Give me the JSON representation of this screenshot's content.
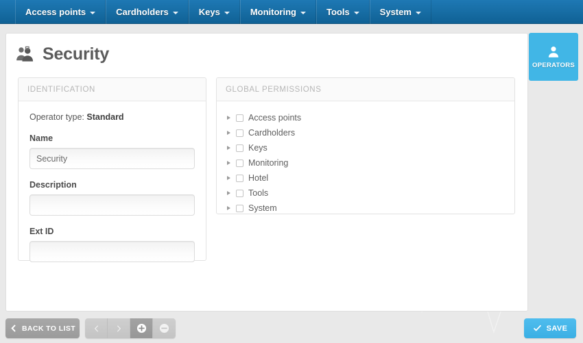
{
  "navbar": {
    "items": [
      {
        "label": "Access points",
        "icon": "chevron-down-icon"
      },
      {
        "label": "Cardholders",
        "icon": "chevron-down-icon"
      },
      {
        "label": "Keys",
        "icon": "chevron-down-icon"
      },
      {
        "label": "Monitoring",
        "icon": "chevron-down-icon"
      },
      {
        "label": "Tools",
        "icon": "chevron-down-icon"
      },
      {
        "label": "System",
        "icon": "chevron-down-icon"
      }
    ]
  },
  "side_tab": {
    "label": "OPERATORS",
    "icon": "user-icon",
    "color": "#41b6e6"
  },
  "header": {
    "title": "Security",
    "icon": "operators-users-icon"
  },
  "identification": {
    "panel_title": "IDENTIFICATION",
    "operator_type_label": "Operator type:",
    "operator_type_value": "Standard",
    "fields": [
      {
        "label": "Name",
        "value": "Security",
        "placeholder": ""
      },
      {
        "label": "Description",
        "value": "",
        "placeholder": ""
      },
      {
        "label": "Ext ID",
        "value": "",
        "placeholder": ""
      }
    ]
  },
  "permissions": {
    "panel_title": "GLOBAL PERMISSIONS",
    "items": [
      {
        "label": "Access points",
        "checked": false,
        "expanded": false
      },
      {
        "label": "Cardholders",
        "checked": false,
        "expanded": false
      },
      {
        "label": "Keys",
        "checked": false,
        "expanded": false
      },
      {
        "label": "Monitoring",
        "checked": false,
        "expanded": false
      },
      {
        "label": "Hotel",
        "checked": false,
        "expanded": false
      },
      {
        "label": "Tools",
        "checked": false,
        "expanded": false
      },
      {
        "label": "System",
        "checked": false,
        "expanded": false
      }
    ]
  },
  "footer": {
    "back_label": "BACK TO LIST",
    "back_icon": "chevron-left-icon",
    "nav_buttons": [
      {
        "name": "prev-record-button",
        "icon": "chevron-left-icon",
        "active": false
      },
      {
        "name": "next-record-button",
        "icon": "chevron-right-icon",
        "active": false
      },
      {
        "name": "add-record-button",
        "icon": "plus-circle-icon",
        "active": true
      },
      {
        "name": "delete-record-button",
        "icon": "minus-circle-icon",
        "active": false
      }
    ],
    "save_label": "SAVE",
    "save_icon": "check-icon",
    "save_color": "#3aafe4"
  }
}
